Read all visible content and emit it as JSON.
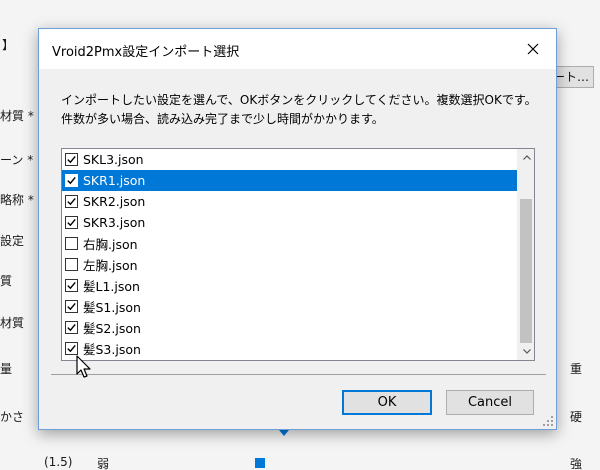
{
  "background": {
    "labels_left": [
      "材質 *",
      "ーン *",
      "略称 *",
      "設定",
      "質",
      "材質",
      "量",
      "かさ",
      "(1.5)",
      "弱"
    ],
    "labels_right": [
      "重",
      "硬",
      "強"
    ],
    "right_button": "ート…",
    "bracket": "】"
  },
  "dialog": {
    "title": "Vroid2Pmx設定インポート選択",
    "instructions": [
      "インポートしたい設定を選んで、OKボタンをクリックしてください。複数選択OKです。",
      "件数が多い場合、読み込み完了まで少し時間がかかります。"
    ],
    "items": [
      {
        "label": "SKL3.json",
        "checked": true,
        "selected": false
      },
      {
        "label": "SKR1.json",
        "checked": true,
        "selected": true
      },
      {
        "label": "SKR2.json",
        "checked": true,
        "selected": false
      },
      {
        "label": "SKR3.json",
        "checked": true,
        "selected": false
      },
      {
        "label": "右胸.json",
        "checked": false,
        "selected": false
      },
      {
        "label": "左胸.json",
        "checked": false,
        "selected": false
      },
      {
        "label": "髪L1.json",
        "checked": true,
        "selected": false
      },
      {
        "label": "髪S1.json",
        "checked": true,
        "selected": false
      },
      {
        "label": "髪S2.json",
        "checked": true,
        "selected": false
      },
      {
        "label": "髪S3.json",
        "checked": true,
        "selected": false
      }
    ],
    "ok_label": "OK",
    "cancel_label": "Cancel"
  },
  "colors": {
    "selection": "#0078d7",
    "accent_border": "#0078d7"
  }
}
